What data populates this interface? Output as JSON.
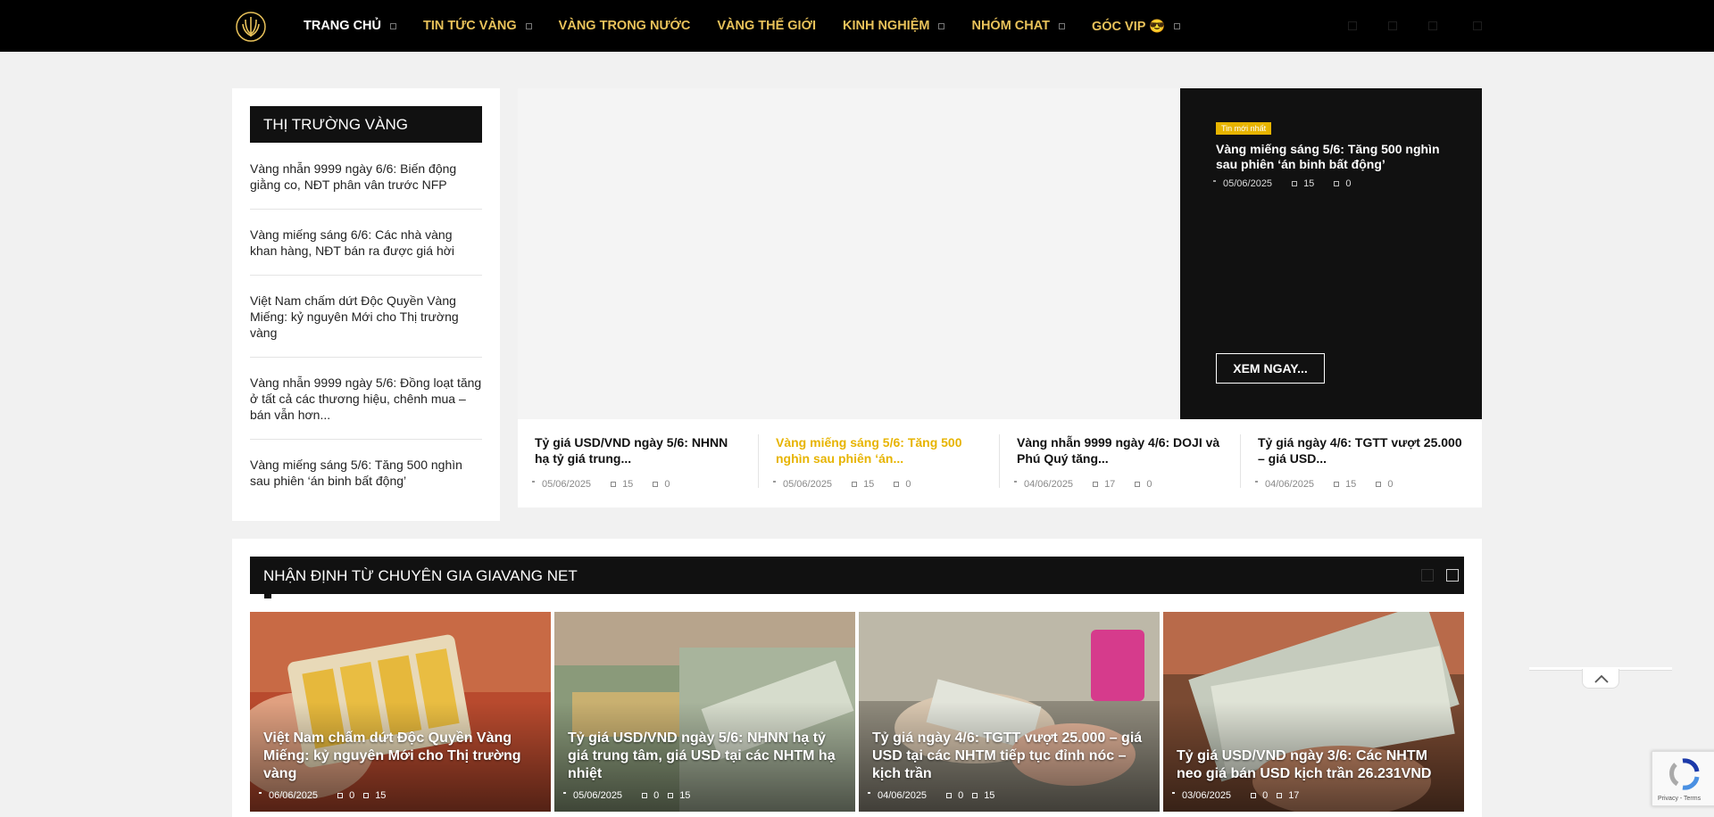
{
  "nav": {
    "items": [
      {
        "label": "TRANG CHỦ",
        "has_caret": true
      },
      {
        "label": "TIN TỨC VÀNG",
        "has_caret": true
      },
      {
        "label": "VÀNG TRONG NƯỚC",
        "has_caret": false
      },
      {
        "label": "VÀNG THẾ GIỚI",
        "has_caret": false
      },
      {
        "label": "KINH NGHIỆM",
        "has_caret": true
      },
      {
        "label": "NHÓM CHAT",
        "has_caret": true
      },
      {
        "label": "GÓC VIP 😎",
        "has_caret": true
      }
    ]
  },
  "sidebar": {
    "title": "THỊ TRƯỜNG VÀNG",
    "items": [
      "Vàng nhẫn 9999 ngày 6/6: Biến động giằng co, NĐT phân vân trước NFP",
      "Vàng miếng sáng 6/6: Các nhà vàng khan hàng, NĐT bán ra được giá hời",
      "Việt Nam chấm dứt Độc Quyền Vàng Miếng: kỷ nguyên Mới cho Thị trường vàng",
      "Vàng nhẫn 9999 ngày 5/6: Đồng loạt tăng ở tất cả các thương hiệu, chênh mua – bán vẫn hơn...",
      "Vàng miếng sáng 5/6: Tăng 500 nghìn sau phiên ‘án binh bất động’"
    ]
  },
  "feature": {
    "badge": "Tin mới nhất",
    "title": "Vàng miếng sáng 5/6: Tăng 500 nghìn sau phiên ‘án binh bất động’",
    "date": "05/06/2025",
    "views": "15",
    "comments": "0",
    "button": "XEM NGAY..."
  },
  "feature_list": [
    {
      "title": "Tỷ giá USD/VND ngày 5/6: NHNN hạ tỷ giá trung...",
      "date": "05/06/2025",
      "views": "15",
      "comments": "0"
    },
    {
      "title": "Vàng miếng sáng 5/6: Tăng 500 nghìn sau phiên ‘án...",
      "date": "05/06/2025",
      "views": "15",
      "comments": "0"
    },
    {
      "title": "Vàng nhẫn 9999 ngày 4/6: DOJI và Phú Quý tăng...",
      "date": "04/06/2025",
      "views": "17",
      "comments": "0"
    },
    {
      "title": "Tỷ giá ngày 4/6: TGTT vượt 25.000 – giá USD...",
      "date": "04/06/2025",
      "views": "15",
      "comments": "0"
    }
  ],
  "expert": {
    "title": "NHẬN ĐỊNH TỪ CHUYÊN GIA GIAVANG NET",
    "cards": [
      {
        "title": "Việt Nam chấm dứt Độc Quyền Vàng Miếng: kỷ nguyên Mới cho Thị trường vàng",
        "date": "06/06/2025",
        "comments": "0",
        "views": "15"
      },
      {
        "title": "Tỷ giá USD/VND ngày 5/6: NHNN hạ tỷ giá trung tâm, giá USD tại các NHTM hạ nhiệt",
        "date": "05/06/2025",
        "comments": "0",
        "views": "15"
      },
      {
        "title": "Tỷ giá ngày 4/6: TGTT vượt 25.000 – giá USD tại các NHTM tiếp tục đỉnh nóc – kịch trần",
        "date": "04/06/2025",
        "comments": "0",
        "views": "15"
      },
      {
        "title": "Tỷ giá USD/VND ngày 3/6: Các NHTM neo giá bán USD kịch trần 26.231VND",
        "date": "03/06/2025",
        "comments": "0",
        "views": "17"
      }
    ]
  },
  "recaptcha": {
    "text": "Privacy - Terms"
  },
  "colors": {
    "accent": "#e7b400",
    "nav_gold": "#e9c25a",
    "dark": "#111111",
    "page_bg": "#f1f1f1"
  }
}
